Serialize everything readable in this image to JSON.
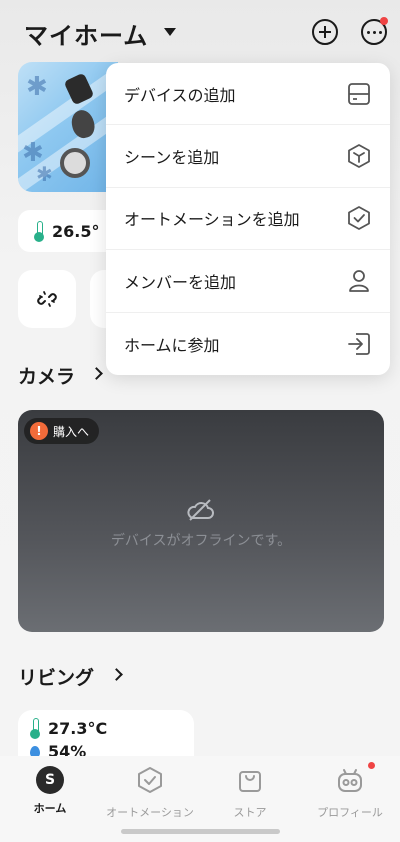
{
  "header": {
    "title": "マイホーム"
  },
  "temperature": {
    "value": "26.5°"
  },
  "sections": {
    "camera": "カメラ",
    "living": "リビング"
  },
  "camera": {
    "buy_badge": "購入へ",
    "offline_text": "デバイスがオフラインです。"
  },
  "living": {
    "temperature": "27.3°C",
    "humidity": "54%"
  },
  "menu": {
    "items": [
      {
        "label": "デバイスの追加",
        "icon": "device-add-icon"
      },
      {
        "label": "シーンを追加",
        "icon": "scene-icon"
      },
      {
        "label": "オートメーションを追加",
        "icon": "automation-icon"
      },
      {
        "label": "メンバーを追加",
        "icon": "person-icon"
      },
      {
        "label": "ホームに参加",
        "icon": "login-icon"
      }
    ]
  },
  "tabs": [
    {
      "label": "ホーム",
      "active": true,
      "avatar_letter": "S"
    },
    {
      "label": "オートメーション",
      "active": false
    },
    {
      "label": "ストア",
      "active": false
    },
    {
      "label": "プロフィール",
      "active": false
    }
  ],
  "colors": {
    "accent_red": "#ef4444",
    "thermo_green": "#28b08a",
    "drop_blue": "#3c8fe0",
    "warn_orange": "#f26b3a"
  }
}
